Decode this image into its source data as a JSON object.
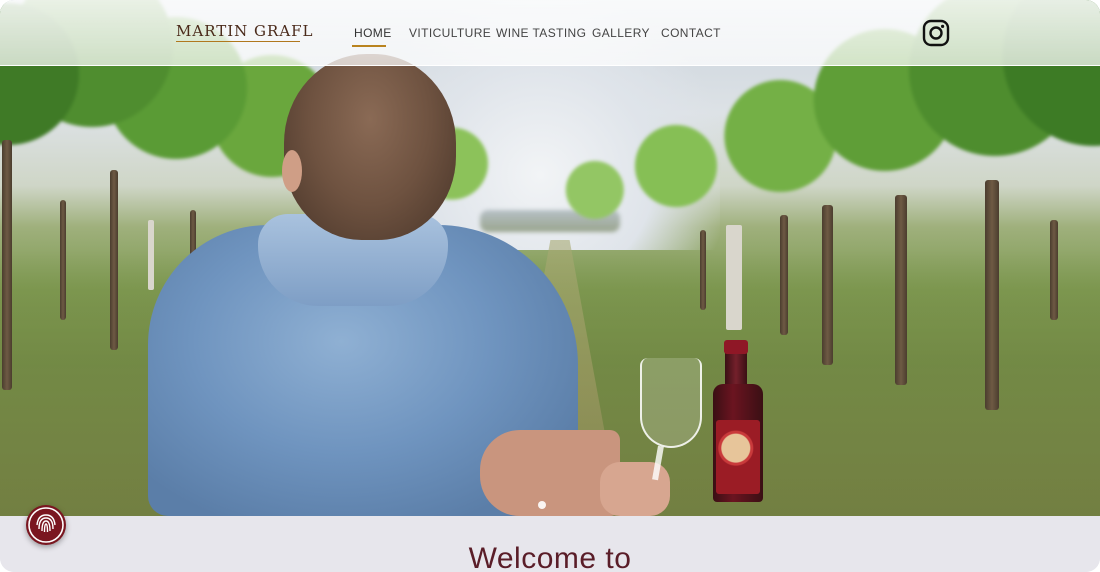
{
  "header": {
    "logo_text": "MARTIN GRAFL",
    "nav": [
      {
        "label": "HOME",
        "active": true
      },
      {
        "label": "VITICULTURE",
        "active": false
      },
      {
        "label": "WINE TASTING",
        "active": false
      },
      {
        "label": "GALLERY",
        "active": false
      },
      {
        "label": "CONTACT",
        "active": false
      }
    ],
    "social_icon": "instagram-icon"
  },
  "hero": {
    "slide_indicator_icon": "slide-dot-icon"
  },
  "main": {
    "welcome_title": "Welcome to"
  },
  "widgets": {
    "fingerprint_icon": "fingerprint-icon"
  },
  "colors": {
    "accent_gold": "#b9831f",
    "brand_wine": "#5a1d28",
    "badge_wine": "#7a1620",
    "nav_text": "#444444"
  }
}
